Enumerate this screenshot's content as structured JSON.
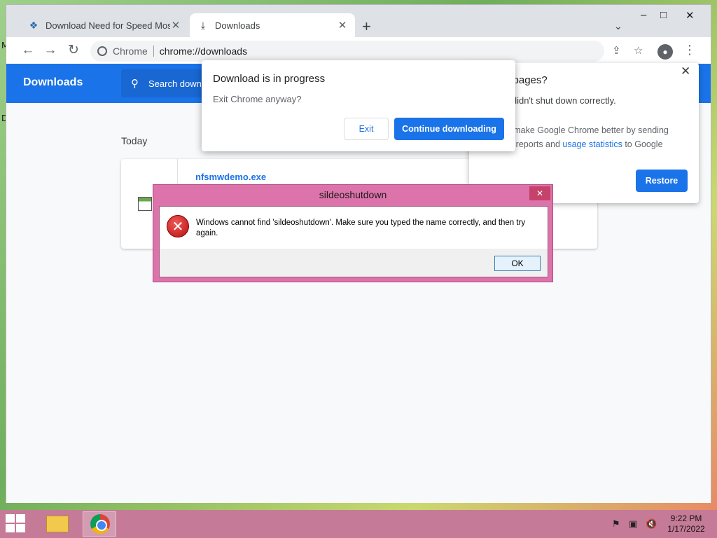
{
  "desktop": {
    "left_fragment_1": "M",
    "left_fragment_2": "D"
  },
  "browser": {
    "tabs": [
      {
        "title": "Download Need for Speed Most",
        "close": "✕"
      },
      {
        "title": "Downloads",
        "close": "✕"
      }
    ],
    "new_tab": "+",
    "tab_search": "⌄",
    "window_controls": {
      "minimize": "–",
      "maximize": "□",
      "close": "✕"
    },
    "toolbar": {
      "back": "←",
      "forward": "→",
      "reload": "↻",
      "omnibox_label": "Chrome",
      "url": "chrome://downloads"
    }
  },
  "downloads_page": {
    "title": "Downloads",
    "search_placeholder": "Search down",
    "section": "Today",
    "file_name": "nfsmwdemo.exe"
  },
  "restore_popup": {
    "title": "e pages?",
    "subtitle": "e didn't shut down correctly.",
    "body_part1": "lp make Google Chrome better by sending",
    "body_part2": "sh reports and ",
    "body_link": "usage statistics",
    "body_part3": " to Google",
    "restore_button": "Restore",
    "close": "✕"
  },
  "download_dialog": {
    "title": "Download is in progress",
    "subtitle": "Exit Chrome anyway?",
    "exit_button": "Exit",
    "continue_button": "Continue downloading"
  },
  "error_dialog": {
    "title": "sildeoshutdown",
    "message": "Windows cannot find 'sildeoshutdown'. Make sure you typed the name correctly, and then try again.",
    "ok_button": "OK",
    "close": "✕",
    "icon_glyph": "✕"
  },
  "taskbar": {
    "time": "9:22 PM",
    "date": "1/17/2022"
  },
  "colors": {
    "chrome_blue": "#1a73e8",
    "error_frame": "#dc73aa",
    "taskbar": "#c57b97"
  }
}
